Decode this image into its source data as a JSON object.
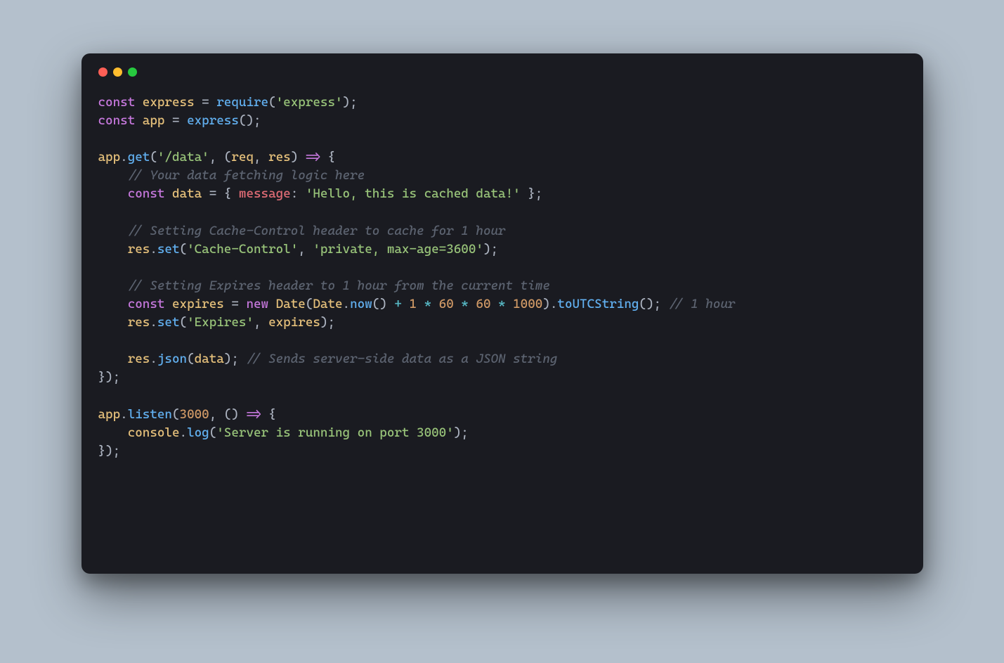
{
  "window": {
    "traffic_red": "close-icon",
    "traffic_yellow": "minimize-icon",
    "traffic_green": "zoom-icon"
  },
  "c": {
    "l1_const": "const",
    "l1_express_id": "express",
    "l1_eq": " = ",
    "l1_require": "require",
    "l1_paren_open": "(",
    "l1_str": "'express'",
    "l1_close": ");",
    "l2_const": "const",
    "l2_app": "app",
    "l2_eq": " = ",
    "l2_express": "express",
    "l2_call": "();",
    "l4_app": "app",
    "l4_dot": ".",
    "l4_get": "get",
    "l4_open": "(",
    "l4_route": "'/data'",
    "l4_comma": ", (",
    "l4_req": "req",
    "l4_comma2": ", ",
    "l4_res": "res",
    "l4_arrow_paren": ") ",
    "l4_arrow": "=>",
    "l4_brace": " {",
    "l5_cmt": "// Your data fetching logic here",
    "l6_const": "const",
    "l6_data": "data",
    "l6_eq": " = { ",
    "l6_key": "message",
    "l6_colon": ": ",
    "l6_str": "'Hello, this is cached data!'",
    "l6_end": " };",
    "l8_cmt": "// Setting Cache-Control header to cache for 1 hour",
    "l9_res": "res",
    "l9_dot": ".",
    "l9_set": "set",
    "l9_open": "(",
    "l9_k": "'Cache-Control'",
    "l9_comma": ", ",
    "l9_v": "'private, max-age=3600'",
    "l9_close": ");",
    "l11_cmt": "// Setting Expires header to 1 hour from the current time",
    "l12_const": "const",
    "l12_expires": "expires",
    "l12_eq": " = ",
    "l12_new": "new",
    "l12_sp": " ",
    "l12_Date": "Date",
    "l12_open": "(",
    "l12_Date2": "Date",
    "l12_dot": ".",
    "l12_now": "now",
    "l12_call": "()",
    "l12_plus_sp1": " ",
    "l12_plus": "+",
    "l12_plus_sp2": " ",
    "l12_n1": "1",
    "l12_mul1_sp1": " ",
    "l12_mul1": "*",
    "l12_mul1_sp2": " ",
    "l12_n2": "60",
    "l12_mul2_sp1": " ",
    "l12_mul2": "*",
    "l12_mul2_sp2": " ",
    "l12_n3": "60",
    "l12_mul3_sp1": " ",
    "l12_mul3": "*",
    "l12_mul3_sp2": " ",
    "l12_n4": "1000",
    "l12_close": ").",
    "l12_toUTC": "toUTCString",
    "l12_end": "();",
    "l12_trail_sp": " ",
    "l12_cmt": "// 1 hour",
    "l13_res": "res",
    "l13_dot": ".",
    "l13_set": "set",
    "l13_open": "(",
    "l13_k": "'Expires'",
    "l13_comma": ", ",
    "l13_expires": "expires",
    "l13_close": ");",
    "l15_res": "res",
    "l15_dot": ".",
    "l15_json": "json",
    "l15_open": "(",
    "l15_data": "data",
    "l15_close": ");",
    "l15_sp": " ",
    "l15_cmt": "// Sends server-side data as a JSON string",
    "l16_end": "});",
    "l18_app": "app",
    "l18_dot": ".",
    "l18_listen": "listen",
    "l18_open": "(",
    "l18_port": "3000",
    "l18_comma": ", () ",
    "l18_arrow": "=>",
    "l18_brace": " {",
    "l19_console": "console",
    "l19_dot": ".",
    "l19_log": "log",
    "l19_open": "(",
    "l19_str": "'Server is running on port 3000'",
    "l19_close": ");",
    "l20_end": "});"
  }
}
